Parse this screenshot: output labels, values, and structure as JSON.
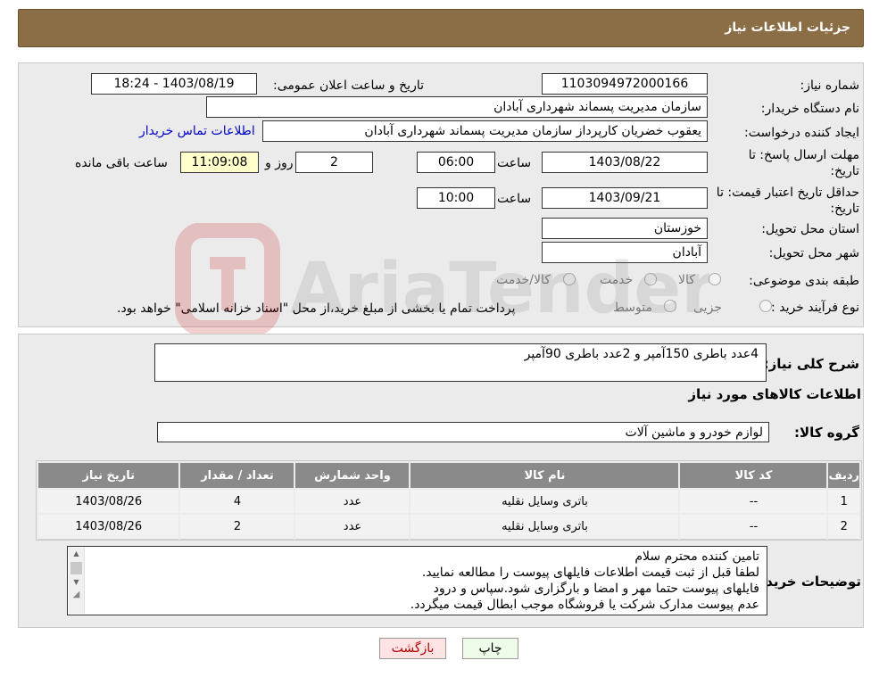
{
  "header": {
    "title": "جزئیات اطلاعات نیاز"
  },
  "form": {
    "need_number_label": "شماره نیاز:",
    "need_number": "1103094972000166",
    "announce_label": "تاریخ و ساعت اعلان عمومی:",
    "announce_value": "1403/08/19 - 18:24",
    "buyer_org_label": "نام دستگاه خریدار:",
    "buyer_org": "سازمان مدیریت پسماند شهرداری آبادان",
    "creator_label": "ایجاد کننده درخواست:",
    "creator": "یعقوب خضریان کارپرداز سازمان مدیریت پسماند شهرداری آبادان",
    "contact_link": "اطلاعات تماس خریدار",
    "deadline_label_1": "مهلت ارسال پاسخ: تا",
    "deadline_label_2": "تاریخ:",
    "deadline_date": "1403/08/22",
    "time_label": "ساعت",
    "deadline_time": "06:00",
    "days_value": "2",
    "days_label": "روز و",
    "remaining_value": "11:09:08",
    "remaining_label": "ساعت باقی مانده",
    "validity_label_1": "حداقل تاریخ اعتبار قیمت: تا",
    "validity_label_2": "تاریخ:",
    "validity_date": "1403/09/21",
    "validity_time": "10:00",
    "province_label": "استان محل تحویل:",
    "province": "خوزستان",
    "city_label": "شهر محل تحویل:",
    "city": "آبادان",
    "category_label": "طبقه بندی موضوعی:",
    "category_options": [
      "کالا",
      "خدمت",
      "کالا/خدمت"
    ],
    "process_label": "نوع فرآیند خرید :",
    "process_options": [
      "جزیی",
      "متوسط"
    ],
    "process_note": "پرداخت تمام یا بخشی از مبلغ خرید،از محل \"اسناد خزانه اسلامی\" خواهد بود."
  },
  "description": {
    "label": "شرح کلی نیاز:",
    "value": "4عدد باطری 150آمپر و 2عدد باطری 90آمپر"
  },
  "goods": {
    "section_title": "اطلاعات کالاهای مورد نیاز",
    "group_label": "گروه کالا:",
    "group_value": "لوازم خودرو و ماشین آلات",
    "columns": [
      "ردیف",
      "کد کالا",
      "نام کالا",
      "واحد شمارش",
      "تعداد / مقدار",
      "تاریخ نیاز"
    ],
    "rows": [
      [
        "1",
        "--",
        "باتری وسایل نقلیه",
        "عدد",
        "4",
        "1403/08/26"
      ],
      [
        "2",
        "--",
        "باتری وسایل نقلیه",
        "عدد",
        "2",
        "1403/08/26"
      ]
    ]
  },
  "notes": {
    "label": "توضیحات خریدار:",
    "lines": [
      "تامین کننده محترم سلام",
      "لطفا قبل از ثبت قیمت اطلاعات فایلهای پیوست را مطالعه نمایید.",
      "فایلهای پیوست حتما مهر و امضا و بارگزاری شود.سپاس و درود",
      "عدم پیوست مدارک شرکت یا فروشگاه موجب ابطال قیمت میگردد."
    ]
  },
  "buttons": {
    "print": "چاپ",
    "back": "بازگشت"
  },
  "watermark": {
    "text": "AriaTender.neT"
  },
  "colors": {
    "header_bg": "#8b6d46",
    "table_header_bg": "#8a8a8a",
    "print_btn_bg": "#eefbe8",
    "back_btn_bg": "#fde3e3"
  }
}
